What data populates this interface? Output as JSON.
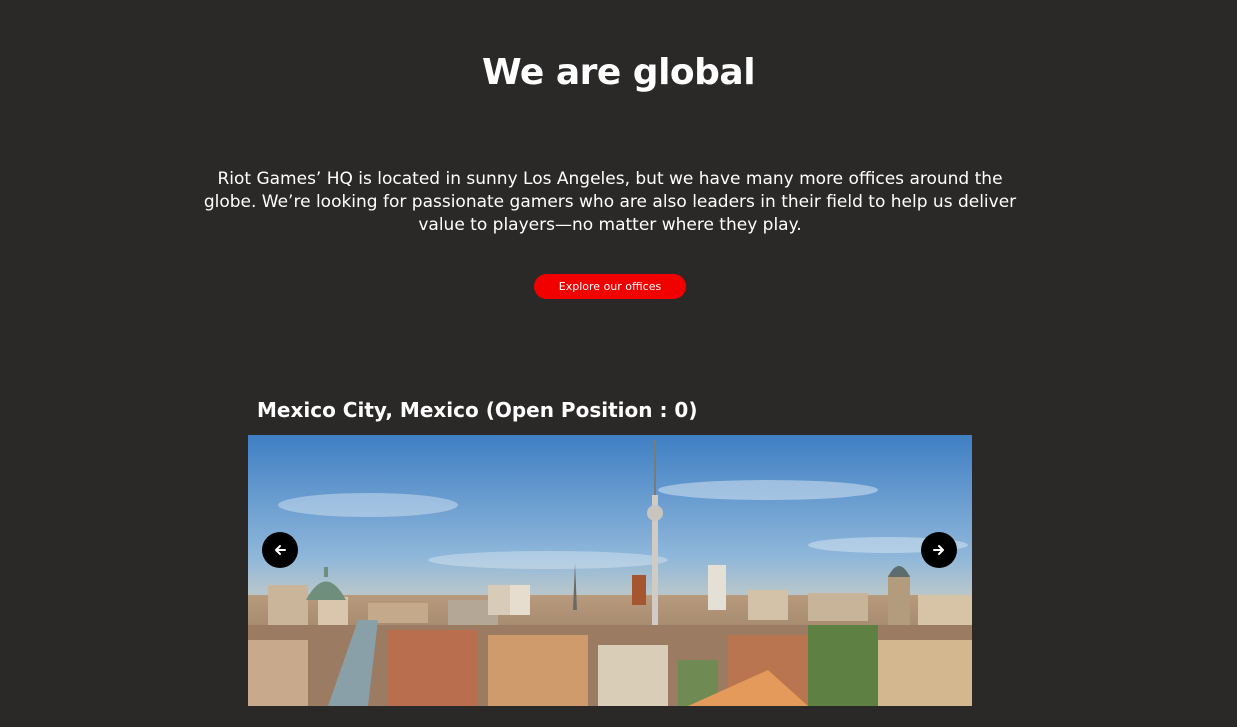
{
  "hero": {
    "title": "We are global",
    "description": "Riot Games’ HQ is located in sunny Los Angeles, but we have many more offices around the globe. We’re looking for passionate gamers who are also leaders in their field to help us deliver value to players—no matter where they play.",
    "cta_label": "Explore our offices"
  },
  "carousel": {
    "office_title": "Mexico City, Mexico (Open Position : 0)",
    "prev_icon": "arrow-left-icon",
    "next_icon": "arrow-right-icon",
    "image_subject": "city-skyline-photo"
  },
  "colors": {
    "background": "#2b2928",
    "accent": "#f20000",
    "text": "#ffffff",
    "arrow_bg": "#000000"
  }
}
